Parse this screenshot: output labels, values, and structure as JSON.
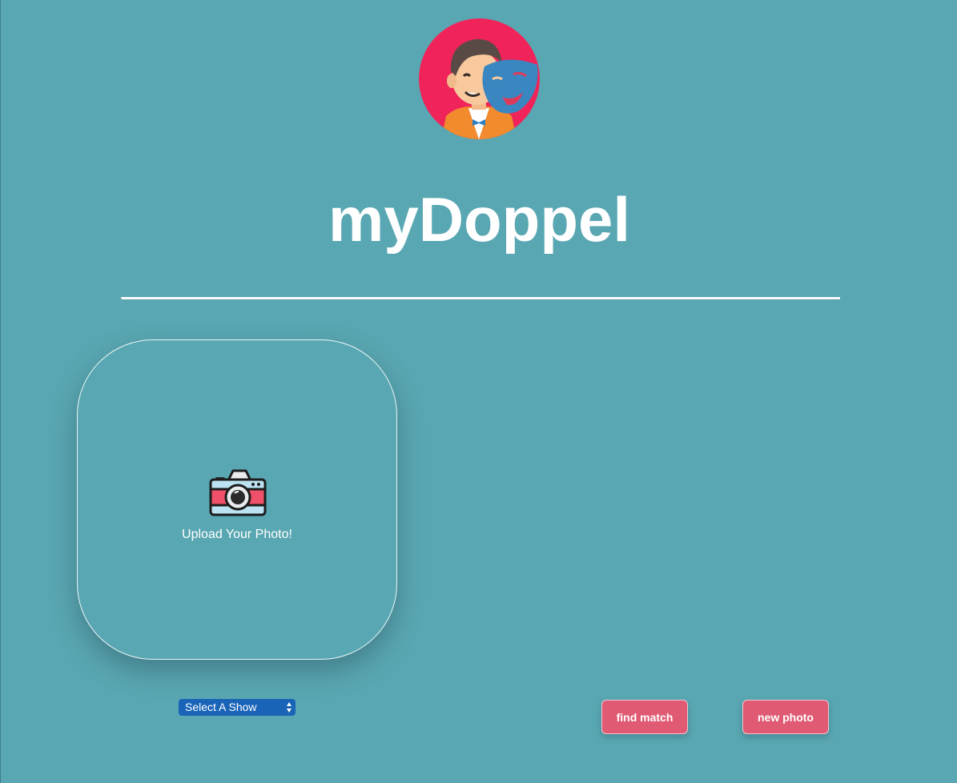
{
  "header": {
    "logo_icon": "actor-with-theater-mask-icon",
    "title": "myDoppel"
  },
  "upload": {
    "icon": "camera-icon",
    "label": "Upload Your Photo!"
  },
  "show_select": {
    "selected": "Select A Show"
  },
  "actions": {
    "find_match": "find match",
    "new_photo": "new photo"
  },
  "colors": {
    "background": "#59a7b2",
    "button": "#e05a73",
    "select": "#1a64b8",
    "logo_circle": "#f0245a"
  }
}
